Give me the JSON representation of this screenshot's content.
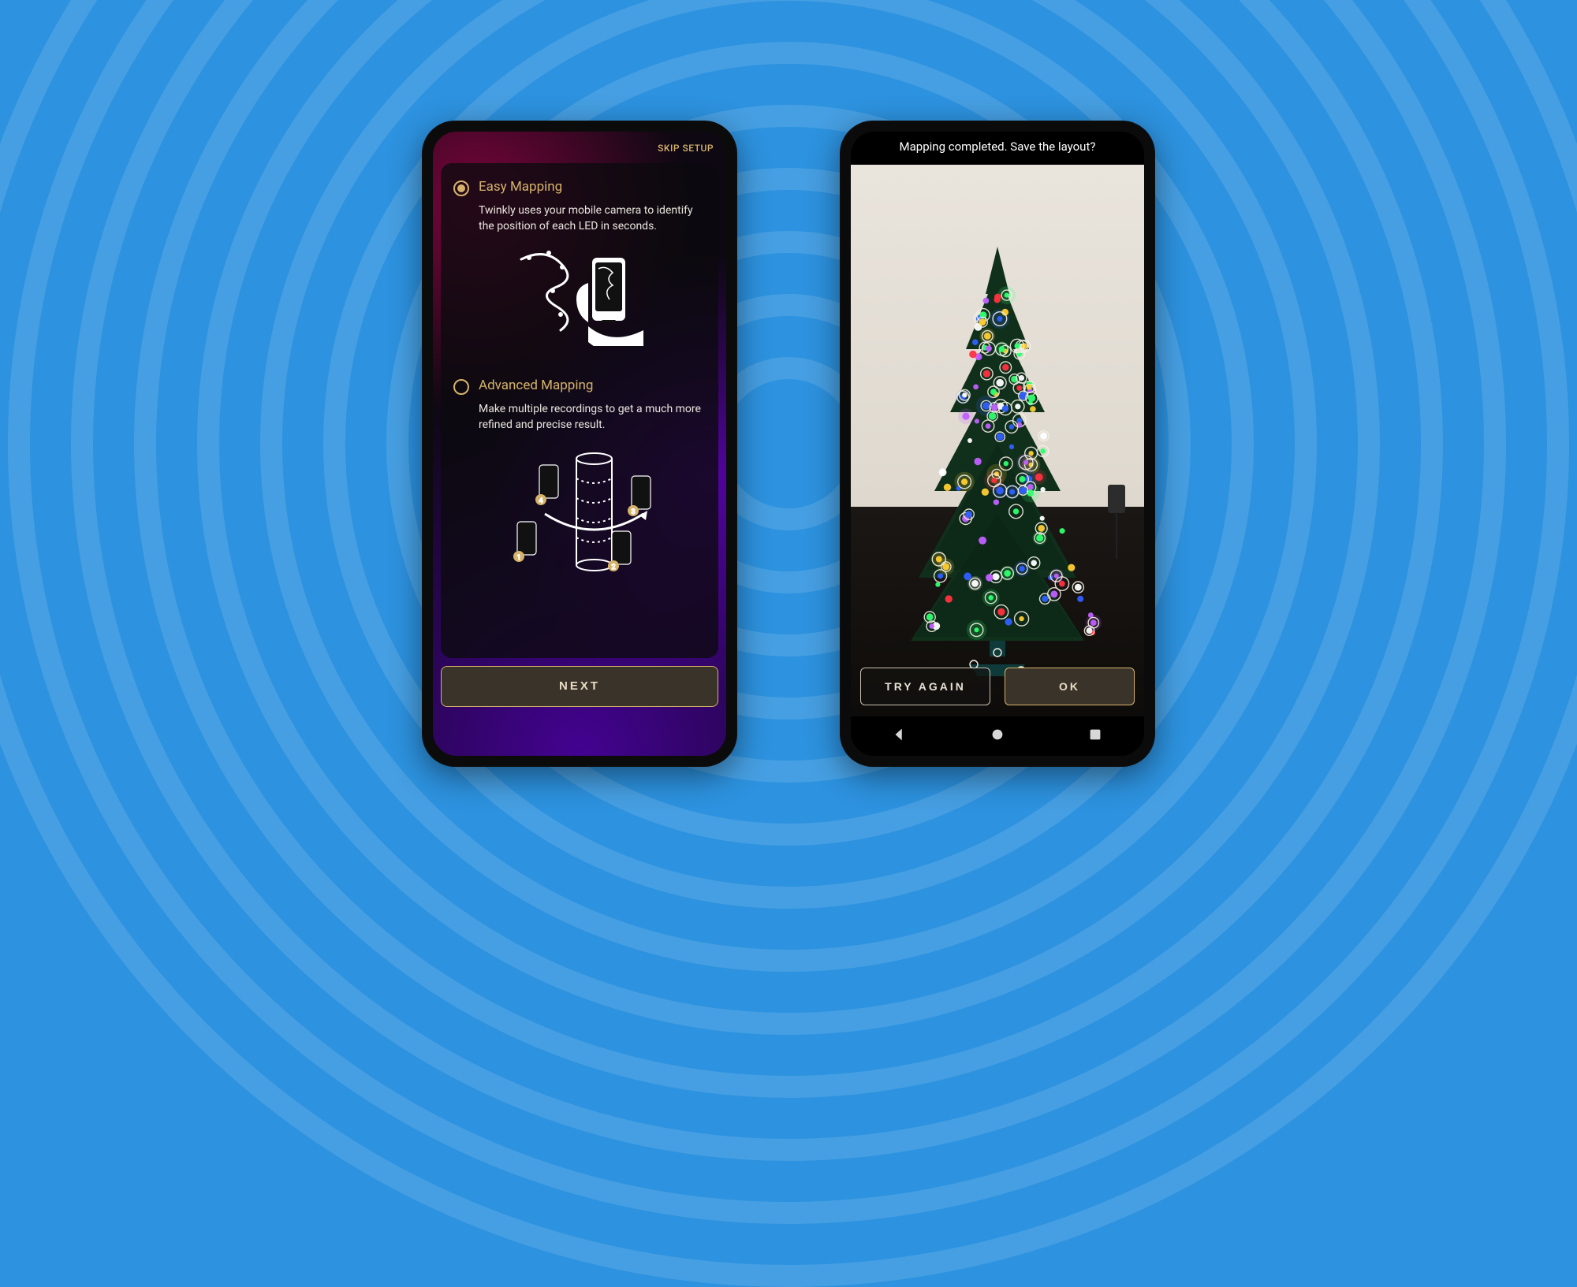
{
  "colors": {
    "accent": "#d6b36a",
    "bg_blue": "#2d92df"
  },
  "left": {
    "skip_label": "SKIP SETUP",
    "options": [
      {
        "title": "Easy Mapping",
        "desc": "Twinkly uses your mobile camera to identify the position of each LED in seconds.",
        "selected": true
      },
      {
        "title": "Advanced Mapping",
        "desc": "Make multiple recordings to get a much more refined and precise result.",
        "selected": false
      }
    ],
    "next_label": "NEXT"
  },
  "right": {
    "prompt": "Mapping completed. Save the layout?",
    "try_again_label": "TRY AGAIN",
    "ok_label": "OK"
  }
}
